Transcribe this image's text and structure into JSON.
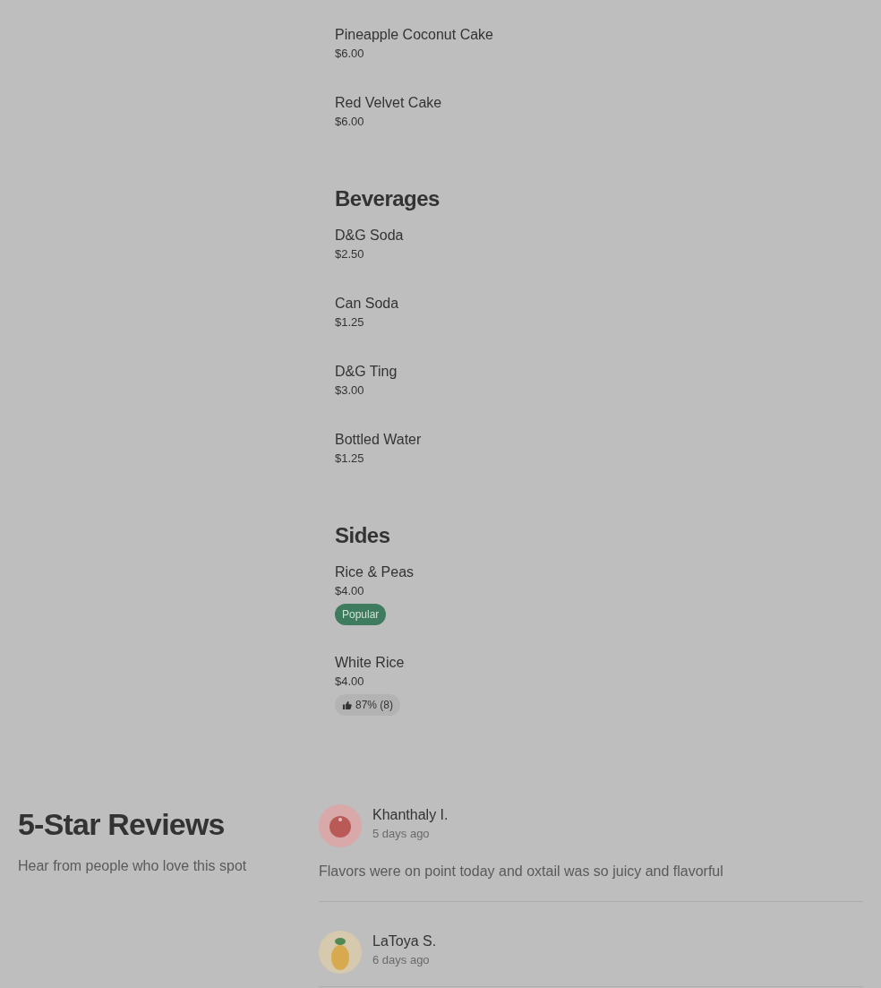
{
  "menu_sections": [
    {
      "items": [
        {
          "name": "Pineapple Coconut Cake",
          "price": "$6.00"
        },
        {
          "name": "Red Velvet Cake",
          "price": "$6.00"
        }
      ]
    },
    {
      "heading": "Beverages",
      "items": [
        {
          "name": "D&G Soda",
          "price": "$2.50"
        },
        {
          "name": "Can Soda",
          "price": "$1.25"
        },
        {
          "name": "D&G Ting",
          "price": "$3.00"
        },
        {
          "name": "Bottled Water",
          "price": "$1.25"
        }
      ]
    },
    {
      "heading": "Sides",
      "items": [
        {
          "name": "Rice & Peas",
          "price": "$4.00",
          "badge": {
            "kind": "popular",
            "label": "Popular"
          }
        },
        {
          "name": "White Rice",
          "price": "$4.00",
          "badge": {
            "kind": "rating",
            "label": "87% (8)"
          }
        }
      ]
    }
  ],
  "reviews": {
    "heading": "5-Star Reviews",
    "subheading": "Hear from people who love this spot",
    "items": [
      {
        "author": "Khanthaly I.",
        "kind": "apple",
        "time": "5 days ago",
        "text": "Flavors were on point today and oxtail was so juicy and flavorful"
      },
      {
        "author": "LaToya S.",
        "kind": "pineapple",
        "time": "6 days ago"
      }
    ]
  }
}
